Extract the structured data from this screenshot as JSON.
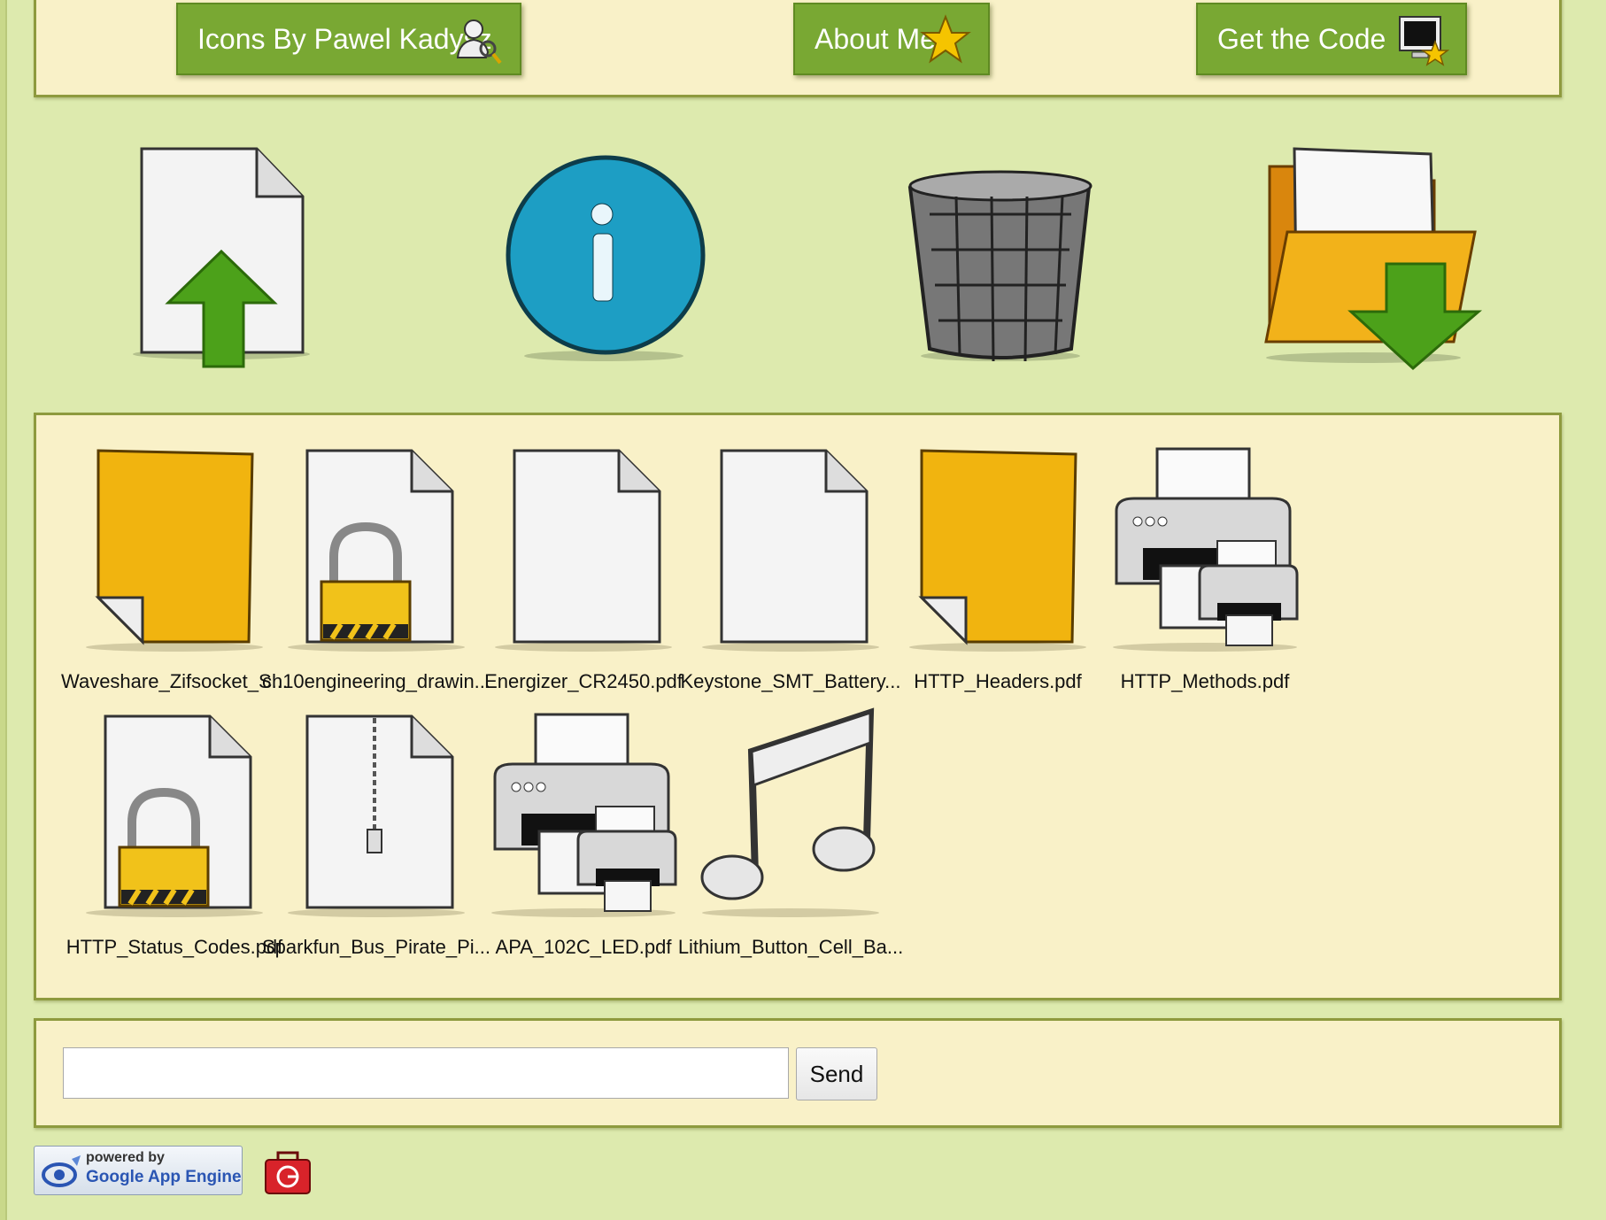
{
  "nav": {
    "buttons": [
      {
        "label": "Icons By Pawel Kadysz",
        "icon": "user-search-icon"
      },
      {
        "label": "About Me",
        "icon": "star-icon"
      },
      {
        "label": "Get the Code",
        "icon": "monitor-star-icon"
      }
    ]
  },
  "toolbar_icons": [
    "upload-file-icon",
    "info-icon",
    "trash-icon",
    "download-folder-icon"
  ],
  "files": [
    {
      "name": "Waveshare_Zifsocket_S...",
      "icon": "yellow-document-icon"
    },
    {
      "name": "ch10engineering_drawin...",
      "icon": "locked-document-icon"
    },
    {
      "name": "Energizer_CR2450.pdf",
      "icon": "document-icon"
    },
    {
      "name": "Keystone_SMT_Battery...",
      "icon": "document-icon"
    },
    {
      "name": "HTTP_Headers.pdf",
      "icon": "yellow-document-icon"
    },
    {
      "name": "HTTP_Methods.pdf",
      "icon": "printer-icon"
    },
    {
      "name": "HTTP_Status_Codes.pdf",
      "icon": "locked-document-icon"
    },
    {
      "name": "Sparkfun_Bus_Pirate_Pi...",
      "icon": "zip-document-icon"
    },
    {
      "name": "APA_102C_LED.pdf",
      "icon": "printer-icon"
    },
    {
      "name": "Lithium_Button_Cell_Ba...",
      "icon": "music-note-icon"
    }
  ],
  "message_box": {
    "value": "",
    "send_label": "Send"
  },
  "footer": {
    "powered_by": "powered by",
    "app_engine": "Google App Engine",
    "badge_icon": "red-g-toolbox-icon"
  }
}
